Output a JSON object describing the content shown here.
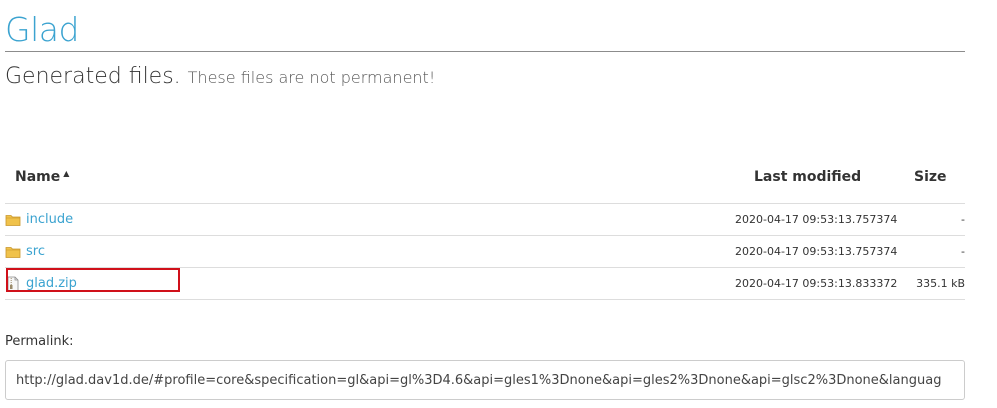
{
  "header": {
    "title": "Glad",
    "subtitle_main": "Generated files.",
    "subtitle_note": "These files are not permanent!"
  },
  "table": {
    "columns": {
      "name": "Name",
      "last_modified": "Last modified",
      "size": "Size"
    },
    "sort_indicator": "▲",
    "rows": [
      {
        "name": "include",
        "type": "folder",
        "modified": "2020-04-17 09:53:13.757374",
        "size": "-"
      },
      {
        "name": "src",
        "type": "folder",
        "modified": "2020-04-17 09:53:13.757374",
        "size": "-"
      },
      {
        "name": "glad.zip",
        "type": "file",
        "modified": "2020-04-17 09:53:13.833372",
        "size": "335.1 kB"
      }
    ]
  },
  "permalink": {
    "label": "Permalink:",
    "value": "http://glad.dav1d.de/#profile=core&specification=gl&api=gl%3D4.6&api=gles1%3Dnone&api=gles2%3Dnone&api=glsc2%3Dnone&languag"
  },
  "icons": {
    "folder": "folder-icon",
    "file": "zip-file-icon"
  },
  "colors": {
    "accent": "#3ba3d0",
    "highlight": "#d0101a",
    "folder": "#f0c24b"
  }
}
